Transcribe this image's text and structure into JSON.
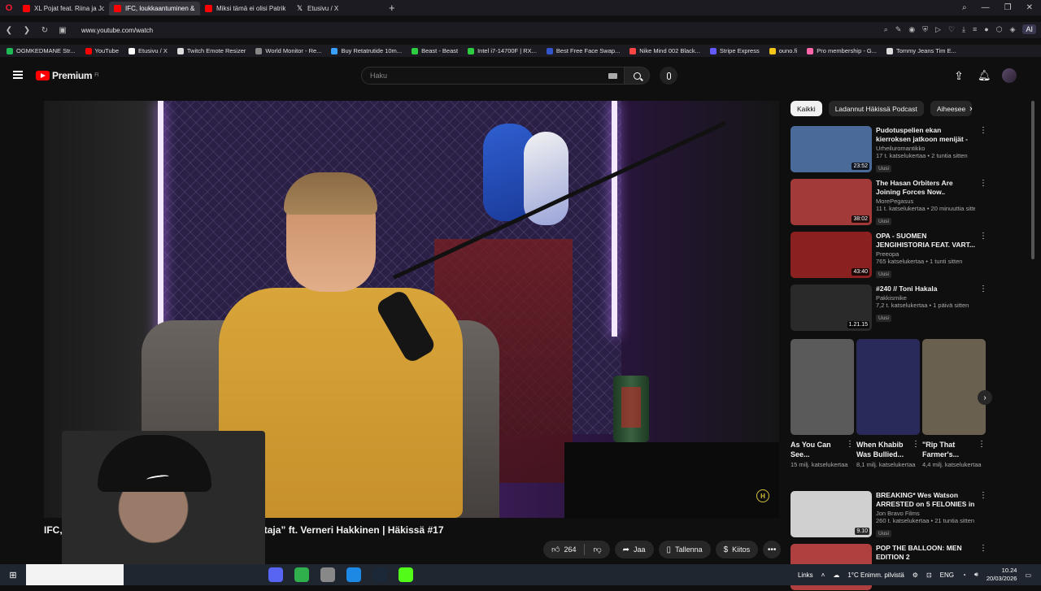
{
  "browser": {
    "tabs": [
      {
        "title": "XL Pojat feat. Riina ja Jonn",
        "icon": "youtube-icon"
      },
      {
        "title": "IFC, loukkaantuminen &",
        "icon": "youtube-icon",
        "active": true
      },
      {
        "title": "Miksi tämä ei olisi Patrik L",
        "icon": "youtube-icon"
      },
      {
        "title": "Etusivu / X",
        "icon": "x-icon"
      }
    ],
    "url": "www.youtube.com/watch",
    "ai_label": "AI",
    "bookmarks": [
      {
        "label": "OGMKEDMANE Str...",
        "color": "#1db954"
      },
      {
        "label": "YouTube",
        "color": "#ff0000"
      },
      {
        "label": "Etusivu / X",
        "color": "#ffffff"
      },
      {
        "label": "Twitch Emote Resizer",
        "color": "#dddddd"
      },
      {
        "label": "World Monitor - Re...",
        "color": "#888888"
      },
      {
        "label": "Buy Retatrutide 10m...",
        "color": "#3aa0ff"
      },
      {
        "label": "Beast - Beast",
        "color": "#2ecc40"
      },
      {
        "label": "Intel i7-14700F | RX...",
        "color": "#2ecc40"
      },
      {
        "label": "Best Free Face Swap...",
        "color": "#3355cc"
      },
      {
        "label": "Nike Mind 002 Black...",
        "color": "#ff4444"
      },
      {
        "label": "Stripe Express",
        "color": "#635bff"
      },
      {
        "label": "ouno.fi",
        "color": "#f5c518"
      },
      {
        "label": "Pro membership - G...",
        "color": "#ff66aa"
      },
      {
        "label": "Tommy Jeans Tim E...",
        "color": "#dddddd"
      }
    ]
  },
  "youtube": {
    "logo_text": "Premium",
    "logo_sup": "FI",
    "search_placeholder": "Haku"
  },
  "video": {
    "title_left": "IFC, l",
    "title_right": "astaja” ft. Verneri Hakkinen | Häkissä #17",
    "badge": "H",
    "actions": {
      "likes": "264",
      "share": "Jaa",
      "save": "Tallenna",
      "thanks": "Kiitos"
    }
  },
  "chips": [
    "Kaikki",
    "Ladannut Häkissä Podcast",
    "Aiheesee"
  ],
  "recommendations": [
    {
      "title": "Pudotuspelien ekan kierroksen jatkoon menijät - yhdellä ei riit...",
      "channel": "Urheiluromantikko",
      "stats": "17 t. katselukertaa • 2 tuntia sitten",
      "duration": "23:52",
      "badge": "Uusi",
      "thumb": "#4a6a9a"
    },
    {
      "title": "The Hasan Orbiters Are Joining Forces Now..",
      "channel": "MorePegasus",
      "stats": "11 t. katselukertaa • 20 minuuttia sitten",
      "duration": "38:02",
      "badge": "Uusi",
      "thumb": "#a33a3a"
    },
    {
      "title": "OPA - SUOMEN JENGIHISTORIA FEAT. VART...",
      "channel": "Preeopa",
      "stats": "765 katselukertaa • 1 tunti sitten",
      "duration": "43:40",
      "badge": "Uusi",
      "thumb": "#8a2020"
    },
    {
      "title": "#240 // Toni Hakala",
      "channel": "Pakkismike",
      "stats": "7,2 t. katselukertaa • 1 päivä sitten",
      "duration": "1.21.15",
      "badge": "Uusi",
      "thumb": "#2a2a2a"
    }
  ],
  "shorts": [
    {
      "title": "As You Can See...",
      "views": "15 milj. katselukertaa",
      "thumb": "#5a5a5a",
      "overlay": "As You Can See..."
    },
    {
      "title": "When Khabib Was Bullied...",
      "views": "8,1 milj. katselukertaa",
      "thumb": "#2a2a5a",
      "overlay": ""
    },
    {
      "title": "\"Rip That Farmer's...",
      "views": "4,4 milj. katselukertaa",
      "thumb": "#6a6050",
      "overlay": ""
    }
  ],
  "recommendations_bottom": [
    {
      "title": "BREAKING* Wes Watson ARRESTED on 5 FELONIES in Florida",
      "channel": "Jon Bravo Films",
      "stats": "260 t. katselukertaa • 21 tuntia sitten",
      "duration": "9.10",
      "badge": "Uusi",
      "thumb": "#d0d0d0"
    },
    {
      "title": "POP THE BALLOON: MEN EDITION 2",
      "channel": "",
      "stats": "",
      "duration": "",
      "badge": "",
      "thumb": "#b04040"
    }
  ],
  "taskbar": {
    "links": "Links",
    "weather": "1°C  Enimm. pilvistä",
    "lang": "ENG",
    "time": "10.24",
    "date": "20/03/2026"
  },
  "colors": {
    "accent": "#ff0000",
    "bg": "#0f0f0f",
    "chip": "#272727"
  }
}
